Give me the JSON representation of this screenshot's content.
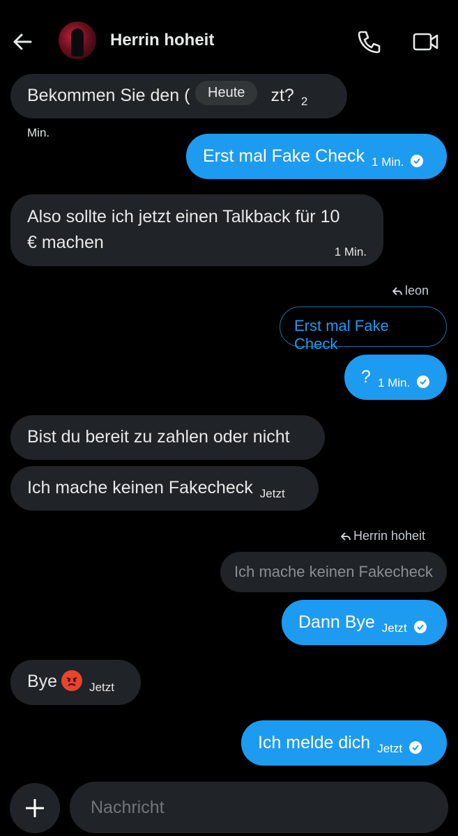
{
  "header": {
    "title": "Herrin hoheit"
  },
  "date_pill": "Heute",
  "messages": [
    {
      "text": "Bekommen Sie den Geld jetzt?",
      "text_visible_start": "Bekommen Sie den (",
      "text_visible_end": "zt?",
      "time": "2 Min."
    },
    {
      "text": "Erst mal Fake Check",
      "time": "1 Min."
    },
    {
      "text_line1": "Also sollte ich jetzt einen Talkback für 10",
      "text_line2": "€ machen",
      "time": "1 Min."
    },
    {
      "reply_to": "leon",
      "quote": "Erst mal Fake Check",
      "text": "?",
      "time": "1 Min."
    },
    {
      "text": "Bist du bereit zu zahlen oder nicht"
    },
    {
      "text": "Ich mache keinen Fakecheck",
      "time": "Jetzt"
    },
    {
      "reply_to": "Herrin hoheit",
      "quote": "Ich mache keinen Fakecheck",
      "text": "Dann Bye",
      "time": "Jetzt"
    },
    {
      "text": "Bye",
      "emoji": "angry-face",
      "time": "Jetzt"
    },
    {
      "text": "Ich melde dich",
      "time": "Jetzt"
    }
  ],
  "composer": {
    "placeholder": "Nachricht"
  },
  "colors": {
    "background": "#000000",
    "incoming_bubble": "#202327",
    "outgoing_bubble": "#1d9bf0",
    "text": "#e7e9ea"
  }
}
